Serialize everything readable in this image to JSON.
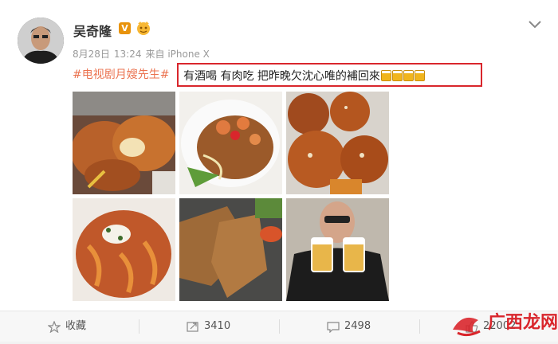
{
  "post": {
    "author": "吴奇隆",
    "verified_badge": "V",
    "date": "8月28日",
    "time": "13:24",
    "source": "来自 iPhone X",
    "hashtag": "#电视剧月嫂先生#",
    "text": "有酒喝 有肉吃 把昨晚欠沈心唯的補回來",
    "emoji": [
      "beer-emoji",
      "beer-emoji",
      "beer-emoji",
      "beer-emoji"
    ],
    "photos": [
      {
        "name": "photo-fried-cutlet"
      },
      {
        "name": "photo-shrimp-noodles"
      },
      {
        "name": "photo-rice-balls"
      },
      {
        "name": "photo-pasta"
      },
      {
        "name": "photo-fried-chicken"
      },
      {
        "name": "photo-selfie-beer"
      }
    ]
  },
  "actions": {
    "favorite_label": "收藏",
    "repost_count": "3410",
    "comment_count": "2498",
    "like_count": "22002"
  },
  "watermark": {
    "text": "广西龙网",
    "color": "#d9262c"
  },
  "colors": {
    "accent": "#eb7350",
    "highlight_border": "#d9262c",
    "verified": "#e8930c"
  }
}
